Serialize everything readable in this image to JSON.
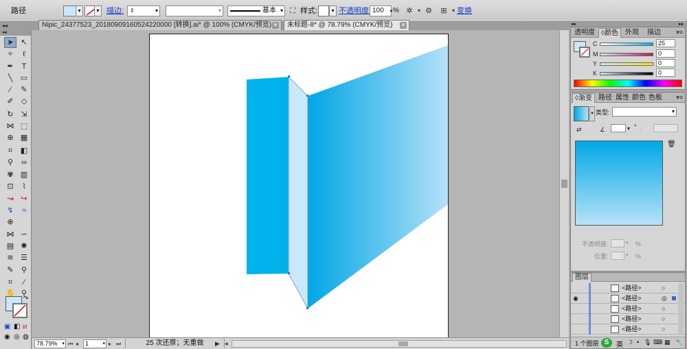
{
  "control_bar": {
    "object_type": "路径",
    "stroke_label": "描边:",
    "stroke_profile": "基本",
    "style_label": "样式:",
    "opacity_label": "不透明度:",
    "opacity_value": "100",
    "opacity_unit": "%",
    "transform_label": "变换",
    "fill_color": "#cce7fb"
  },
  "tabs": [
    {
      "label": "Nipic_24377523_20180909160524220000 [转换].ai* @ 100% (CMYK/预览)"
    },
    {
      "label": "未标题-8* @ 78.79% (CMYK/预览)"
    }
  ],
  "status_bar": {
    "zoom": "78.79%",
    "page": "1",
    "undo_text": "25 次还原；无重做"
  },
  "color_panel": {
    "tabs": [
      "透明度",
      "颜色",
      "外观",
      "描边"
    ],
    "channels": [
      {
        "name": "C",
        "value": "25"
      },
      {
        "name": "M",
        "value": "0"
      },
      {
        "name": "Y",
        "value": "0"
      },
      {
        "name": "K",
        "value": "0"
      }
    ]
  },
  "gradient_panel": {
    "tabs": [
      "渐变",
      "路径",
      "属性",
      "颜色",
      "色板"
    ],
    "type_label": "类型:",
    "angle_unit": "°",
    "opacity_label": "不透明度:",
    "opacity_unit": "%",
    "location_label": "位置:",
    "location_unit": "%",
    "start_color": "#00a8e8",
    "end_color": "#b7e2f7"
  },
  "layers_panel": {
    "tab": "图层",
    "rows": [
      {
        "name": "<路径>"
      },
      {
        "name": "<路径>"
      },
      {
        "name": "<路径>"
      },
      {
        "name": "<路径>"
      },
      {
        "name": "<路径>"
      }
    ],
    "footer": "1 个图层"
  },
  "artwork_colors": {
    "panel_left": "#00b2ec",
    "panel_mid": "#cbe7fa",
    "gradient_start": "#00a6e6",
    "gradient_end": "#b5e1f8",
    "anchor": "#3f6cc0"
  }
}
